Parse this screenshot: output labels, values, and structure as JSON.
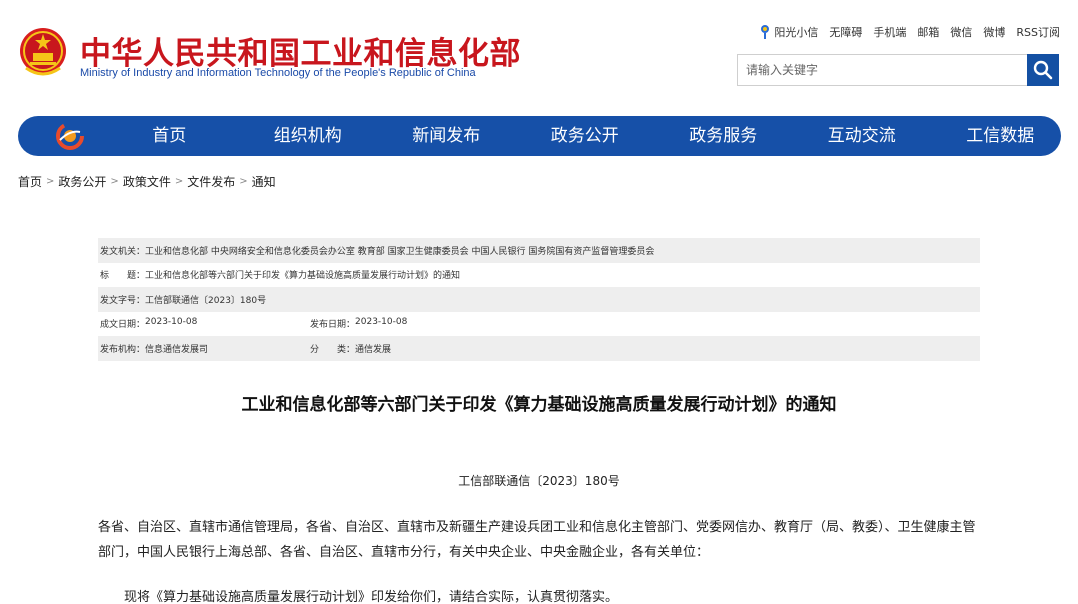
{
  "header": {
    "title_cn": "中华人民共和国工业和信息化部",
    "title_en": "Ministry of Industry and Information Technology of the People's Republic of China",
    "top_links": [
      "阳光小信",
      "无障碍",
      "手机端",
      "邮箱",
      "微信",
      "微博",
      "RSS订阅"
    ],
    "search_placeholder": "请输入关键字"
  },
  "nav": {
    "items": [
      "首页",
      "组织机构",
      "新闻发布",
      "政务公开",
      "政务服务",
      "互动交流",
      "工信数据"
    ]
  },
  "breadcrumb": [
    "首页",
    "政务公开",
    "政策文件",
    "文件发布",
    "通知"
  ],
  "meta": {
    "issuer_label": "发文机关：",
    "issuer": "工业和信息化部 中央网络安全和信息化委员会办公室 教育部 国家卫生健康委员会 中国人民银行 国务院国有资产监督管理委员会",
    "title_label": "标　　题：",
    "title": "工业和信息化部等六部门关于印发《算力基础设施高质量发展行动计划》的通知",
    "docno_label": "发文字号：",
    "docno": "工信部联通信〔2023〕180号",
    "created_label": "成文日期：",
    "created": "2023-10-08",
    "published_label": "发布日期：",
    "published": "2023-10-08",
    "org_label": "发布机构：",
    "org": "信息通信发展司",
    "category_label": "分　　类：",
    "category": "通信发展"
  },
  "document": {
    "title": "工业和信息化部等六部门关于印发《算力基础设施高质量发展行动计划》的通知",
    "number": "工信部联通信〔2023〕180号",
    "para1": "各省、自治区、直辖市通信管理局，各省、自治区、直辖市及新疆生产建设兵团工业和信息化主管部门、党委网信办、教育厅（局、教委）、卫生健康主管部门，中国人民银行上海总部、各省、自治区、直辖市分行，有关中央企业、中央金融企业，各有关单位：",
    "para2": "现将《算力基础设施高质量发展行动计划》印发给你们，请结合实际，认真贯彻落实。"
  },
  "colors": {
    "brand_red": "#c8161d",
    "brand_blue": "#1650a8"
  }
}
